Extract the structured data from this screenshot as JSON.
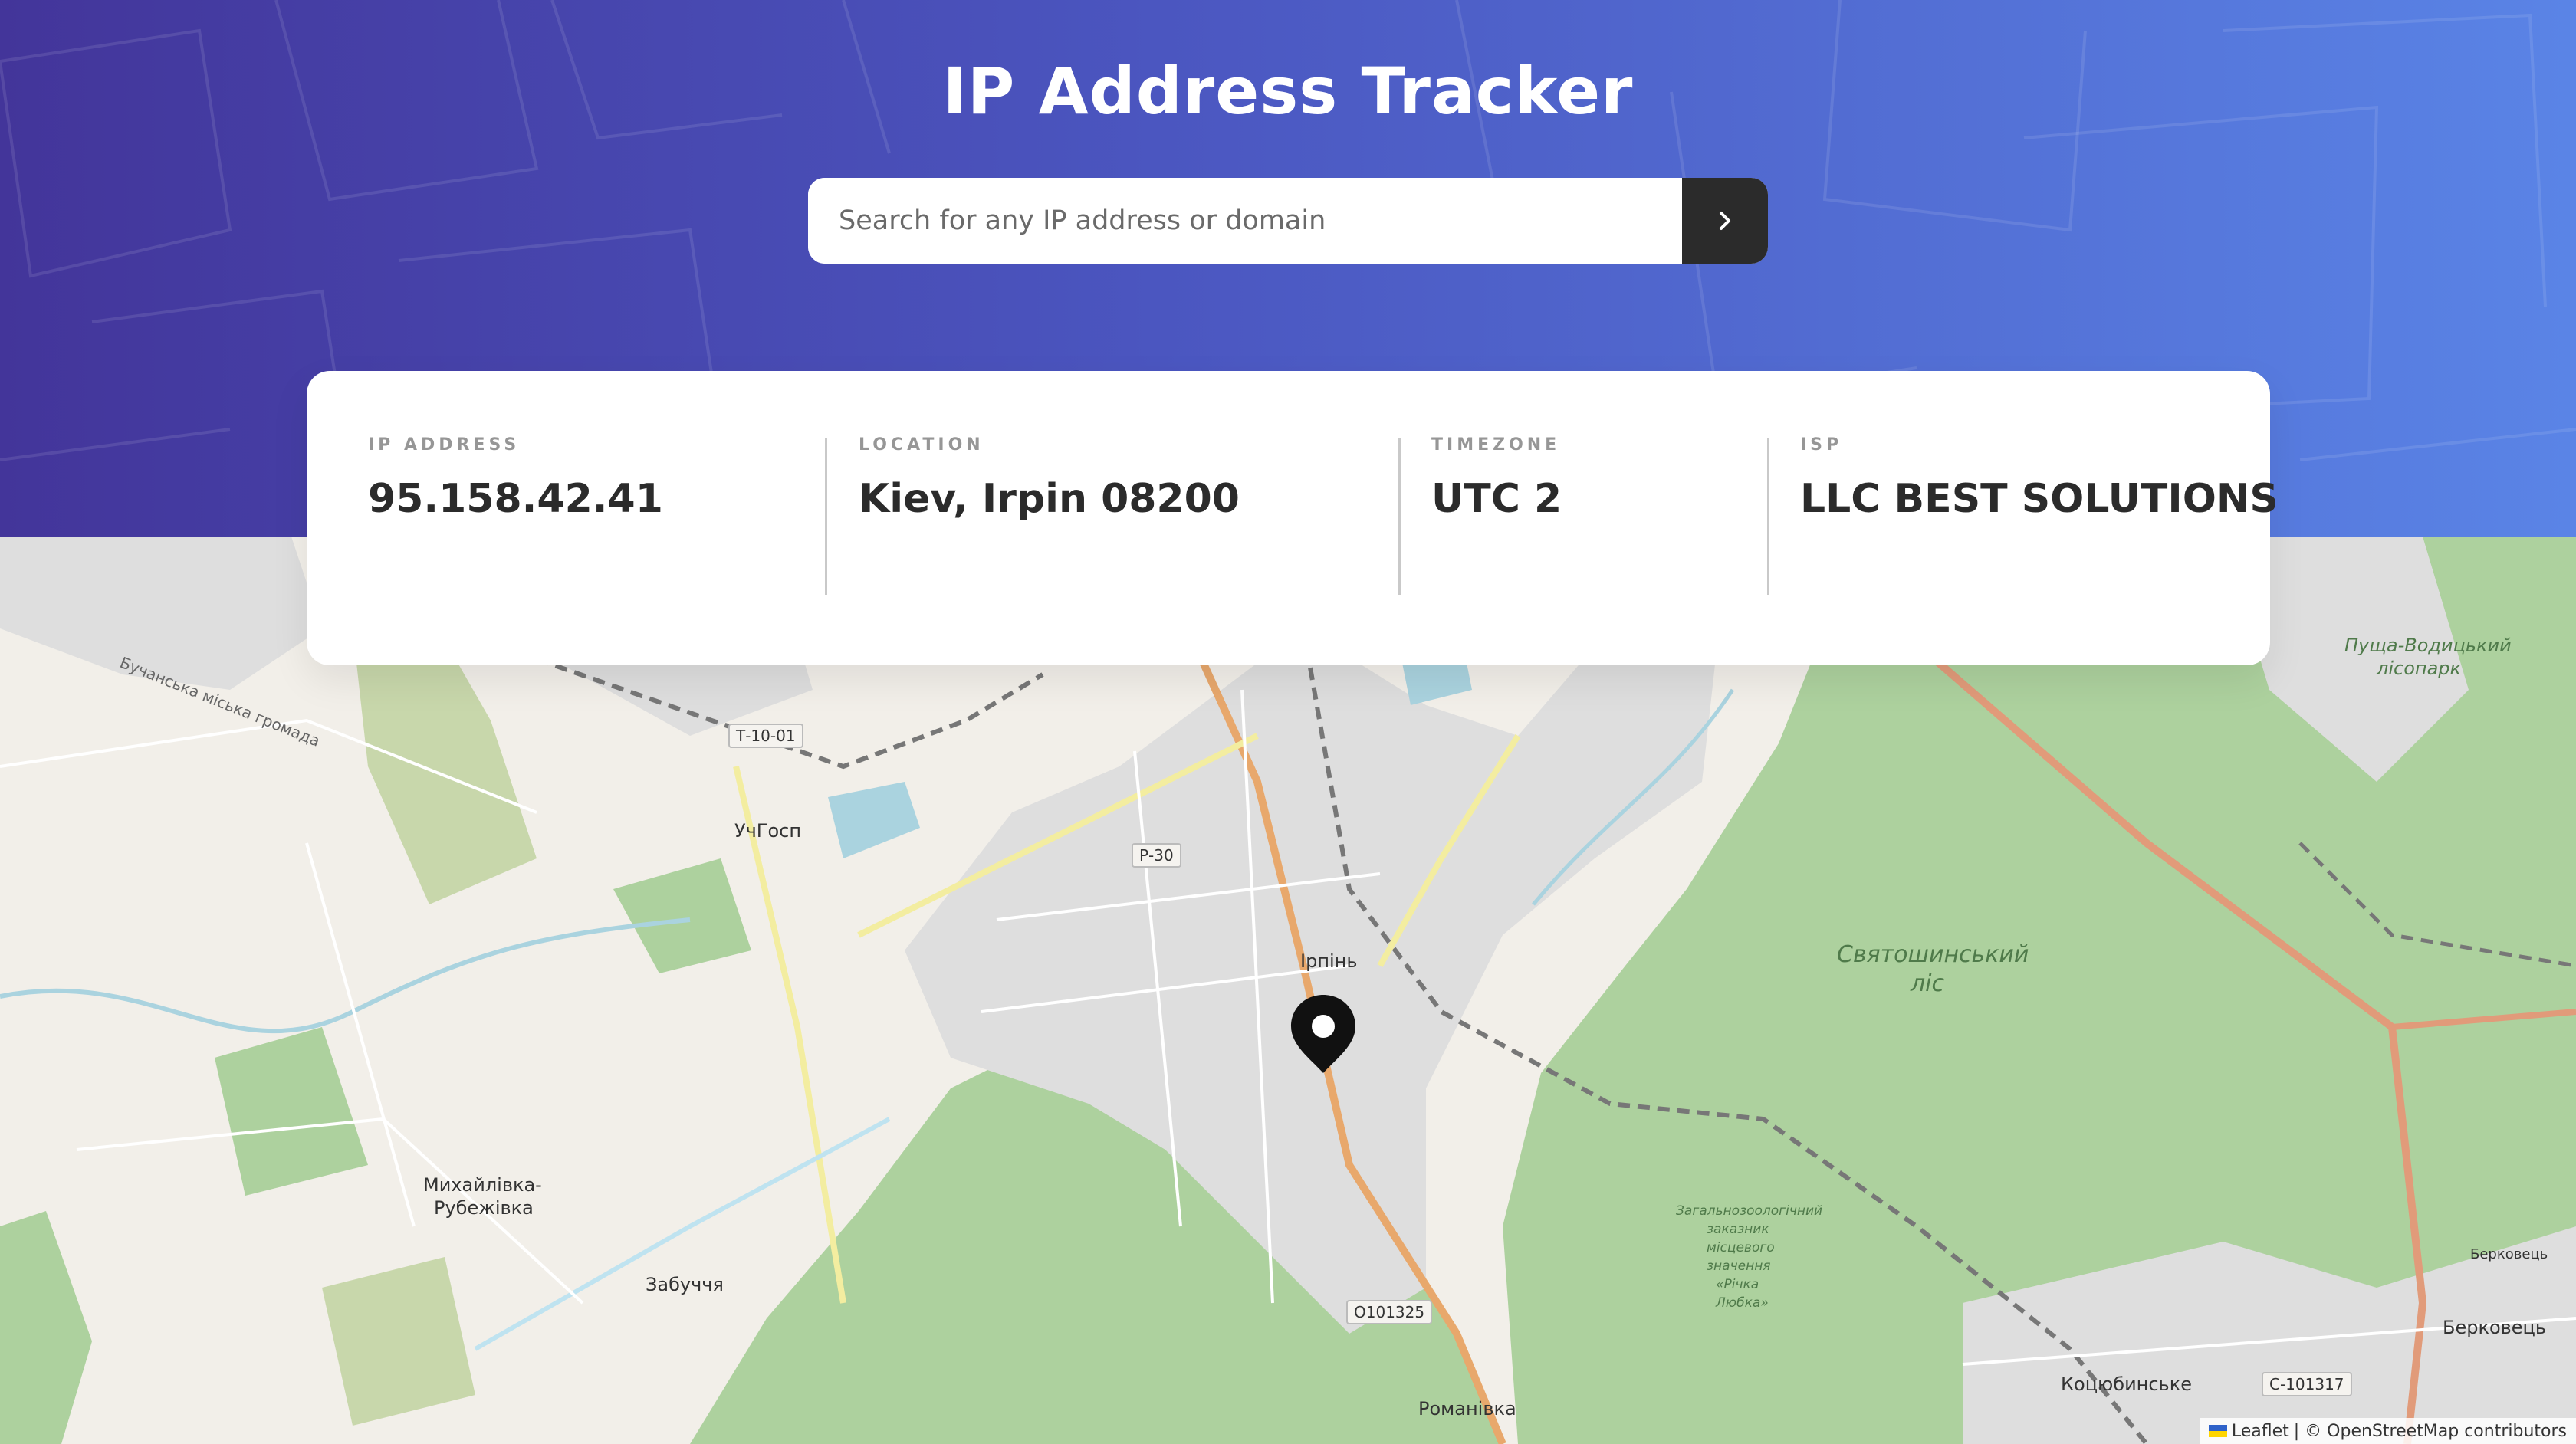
{
  "app": {
    "title": "IP Address Tracker"
  },
  "search": {
    "placeholder": "Search for any IP address or domain",
    "value": "",
    "submit_icon": "chevron-right-icon"
  },
  "info": {
    "ip": {
      "label": "IP ADDRESS",
      "value": "95.158.42.41"
    },
    "location": {
      "label": "LOCATION",
      "value": "Kiev, Irpin 08200"
    },
    "timezone": {
      "label": "TIMEZONE",
      "value": "UTC 2"
    },
    "isp": {
      "label": "ISP",
      "value": "LLC BEST SOLUTIONS"
    }
  },
  "map": {
    "labels": {
      "irpin": "Ірпінь",
      "uchhosp": "УчГосп",
      "mykhailivka": "Михайлівка-",
      "rubezhivka": "Рубежівка",
      "zabuchchia": "Забуччя",
      "romanivka": "Романівка",
      "kotsiubynske": "Коцюбинське",
      "berkovets": "Берковець",
      "berkovets_small": "Берковець",
      "sviatoshynskyi": "Святошинський",
      "lis": "ліс",
      "pushcha_1": "Пуща-Водицький",
      "pushcha_2": "лісопарк",
      "bucha_hromada": "Бучанська міська громада",
      "zakaznyk_1": "Загальнозоологічний",
      "zakaznyk_2": "заказник",
      "zakaznyk_3": "місцевого",
      "zakaznyk_4": "значення",
      "zakaznyk_5": "«Річка",
      "zakaznyk_6": "Любка»"
    },
    "shields": {
      "t1001": "Т-10-01",
      "p30": "Р-30",
      "o101325": "О101325",
      "c101317": "С-101317"
    },
    "attribution": {
      "leaflet": "Leaflet",
      "osm": "| © OpenStreetMap contributors"
    },
    "colors": {
      "forest": "#add19e",
      "residential": "#dedede",
      "water": "#aad3df",
      "primary_road": "#e8a86c"
    }
  }
}
